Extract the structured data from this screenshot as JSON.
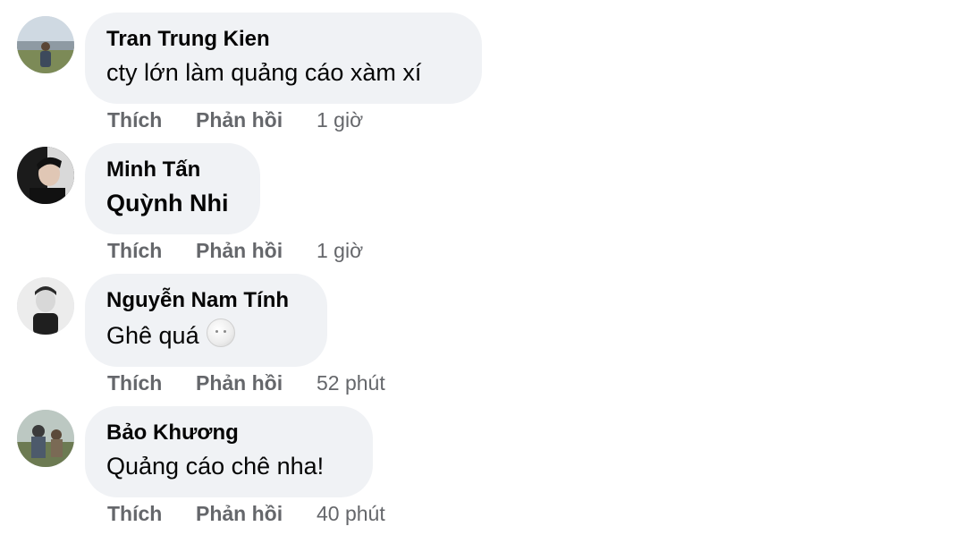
{
  "comments": [
    {
      "author": "Tran Trung Kien",
      "text": "cty lớn làm quảng cáo xàm xí",
      "like": "Thích",
      "reply": "Phản hồi",
      "time": "1 giờ"
    },
    {
      "author": "Minh Tấn",
      "text": "Quỳnh Nhi",
      "like": "Thích",
      "reply": "Phản hồi",
      "time": "1 giờ"
    },
    {
      "author": "Nguyễn Nam Tính",
      "text": "Ghê quá",
      "like": "Thích",
      "reply": "Phản hồi",
      "time": "52 phút"
    },
    {
      "author": "Bảo Khương",
      "text": "Quảng cáo chê nha!",
      "like": "Thích",
      "reply": "Phản hồi",
      "time": "40 phút"
    }
  ],
  "icons": {
    "reaction_emoji": "moon-face-emoji-icon"
  },
  "colors": {
    "bubble": "#f0f2f5",
    "meta": "#65676b",
    "text": "#050505"
  }
}
